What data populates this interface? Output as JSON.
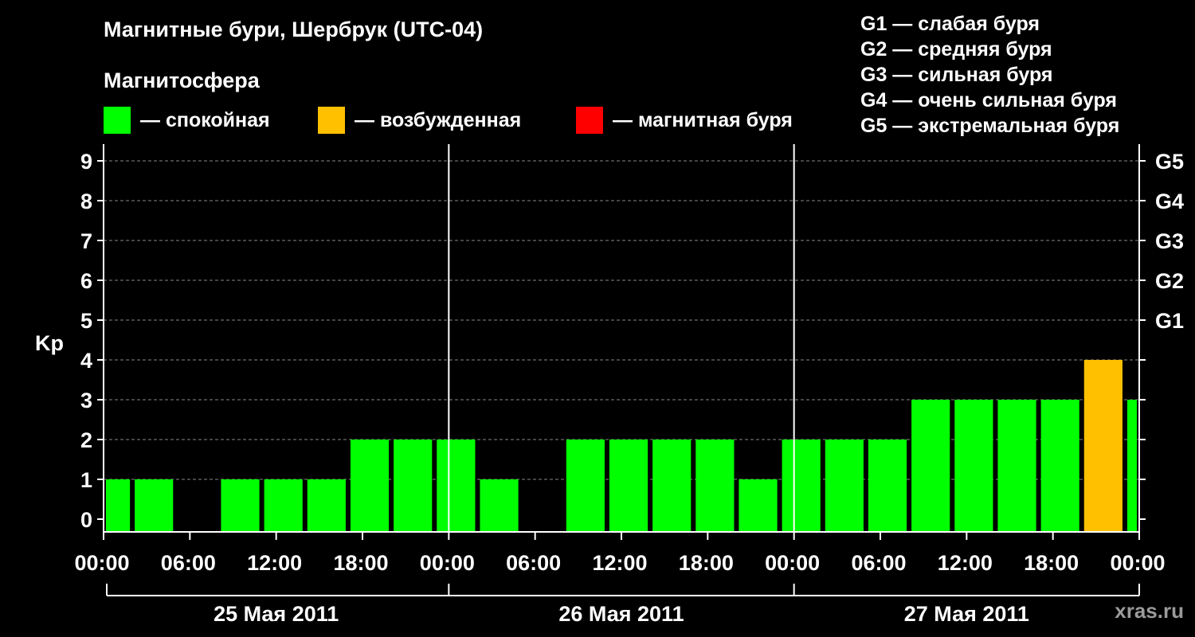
{
  "header": {
    "title": "Магнитные бури, Шербрук (UTC-04)",
    "subtitle": "Магнитосфера"
  },
  "legend": [
    {
      "text": "— спокойная",
      "color": "#00ff00"
    },
    {
      "text": "— возбужденная",
      "color": "#ffc000"
    },
    {
      "text": "— магнитная буря",
      "color": "#ff0000"
    }
  ],
  "g_scale": [
    "G1 — слабая буря",
    "G2 — средняя буря",
    "G3 — сильная буря",
    "G4 — очень сильная буря",
    "G5 — экстремальная буря"
  ],
  "watermark": "xras.ru",
  "colors": {
    "quiet": "#00ff00",
    "active": "#ffc000",
    "storm": "#ff0000",
    "background": "#000000"
  },
  "chart_data": {
    "type": "bar",
    "ylabel": "Kp",
    "ylim": [
      0,
      9
    ],
    "yticks": [
      "0",
      "1",
      "2",
      "3",
      "4",
      "5",
      "6",
      "7",
      "8",
      "9"
    ],
    "right_labels": [
      {
        "kp": 5,
        "label": "G1"
      },
      {
        "kp": 6,
        "label": "G2"
      },
      {
        "kp": 7,
        "label": "G3"
      },
      {
        "kp": 8,
        "label": "G4"
      },
      {
        "kp": 9,
        "label": "G5"
      }
    ],
    "xticks": [
      "00:00",
      "06:00",
      "12:00",
      "18:00",
      "00:00",
      "06:00",
      "12:00",
      "18:00",
      "00:00",
      "06:00",
      "12:00",
      "18:00",
      "00:00"
    ],
    "days": [
      "25 Мая 2011",
      "26 Мая 2011",
      "27 Мая 2011"
    ],
    "grid": "horizontal dashed",
    "bars": [
      {
        "start_h": 0,
        "end_h": 2,
        "kp": 1,
        "level": "quiet"
      },
      {
        "start_h": 2,
        "end_h": 5,
        "kp": 1,
        "level": "quiet"
      },
      {
        "start_h": 5,
        "end_h": 8,
        "kp": 0,
        "level": "quiet"
      },
      {
        "start_h": 8,
        "end_h": 11,
        "kp": 1,
        "level": "quiet"
      },
      {
        "start_h": 11,
        "end_h": 14,
        "kp": 1,
        "level": "quiet"
      },
      {
        "start_h": 14,
        "end_h": 17,
        "kp": 1,
        "level": "quiet"
      },
      {
        "start_h": 17,
        "end_h": 20,
        "kp": 2,
        "level": "quiet"
      },
      {
        "start_h": 20,
        "end_h": 23,
        "kp": 2,
        "level": "quiet"
      },
      {
        "start_h": 23,
        "end_h": 26,
        "kp": 2,
        "level": "quiet"
      },
      {
        "start_h": 26,
        "end_h": 29,
        "kp": 1,
        "level": "quiet"
      },
      {
        "start_h": 29,
        "end_h": 32,
        "kp": 0,
        "level": "quiet"
      },
      {
        "start_h": 32,
        "end_h": 35,
        "kp": 2,
        "level": "quiet"
      },
      {
        "start_h": 35,
        "end_h": 38,
        "kp": 2,
        "level": "quiet"
      },
      {
        "start_h": 38,
        "end_h": 41,
        "kp": 2,
        "level": "quiet"
      },
      {
        "start_h": 41,
        "end_h": 44,
        "kp": 2,
        "level": "quiet"
      },
      {
        "start_h": 44,
        "end_h": 47,
        "kp": 1,
        "level": "quiet"
      },
      {
        "start_h": 47,
        "end_h": 50,
        "kp": 2,
        "level": "quiet"
      },
      {
        "start_h": 50,
        "end_h": 53,
        "kp": 2,
        "level": "quiet"
      },
      {
        "start_h": 53,
        "end_h": 56,
        "kp": 2,
        "level": "quiet"
      },
      {
        "start_h": 56,
        "end_h": 59,
        "kp": 3,
        "level": "quiet"
      },
      {
        "start_h": 59,
        "end_h": 62,
        "kp": 3,
        "level": "quiet"
      },
      {
        "start_h": 62,
        "end_h": 65,
        "kp": 3,
        "level": "quiet"
      },
      {
        "start_h": 65,
        "end_h": 68,
        "kp": 3,
        "level": "quiet"
      },
      {
        "start_h": 68,
        "end_h": 71,
        "kp": 4,
        "level": "active"
      },
      {
        "start_h": 71,
        "end_h": 72,
        "kp": 3,
        "level": "quiet"
      }
    ]
  }
}
